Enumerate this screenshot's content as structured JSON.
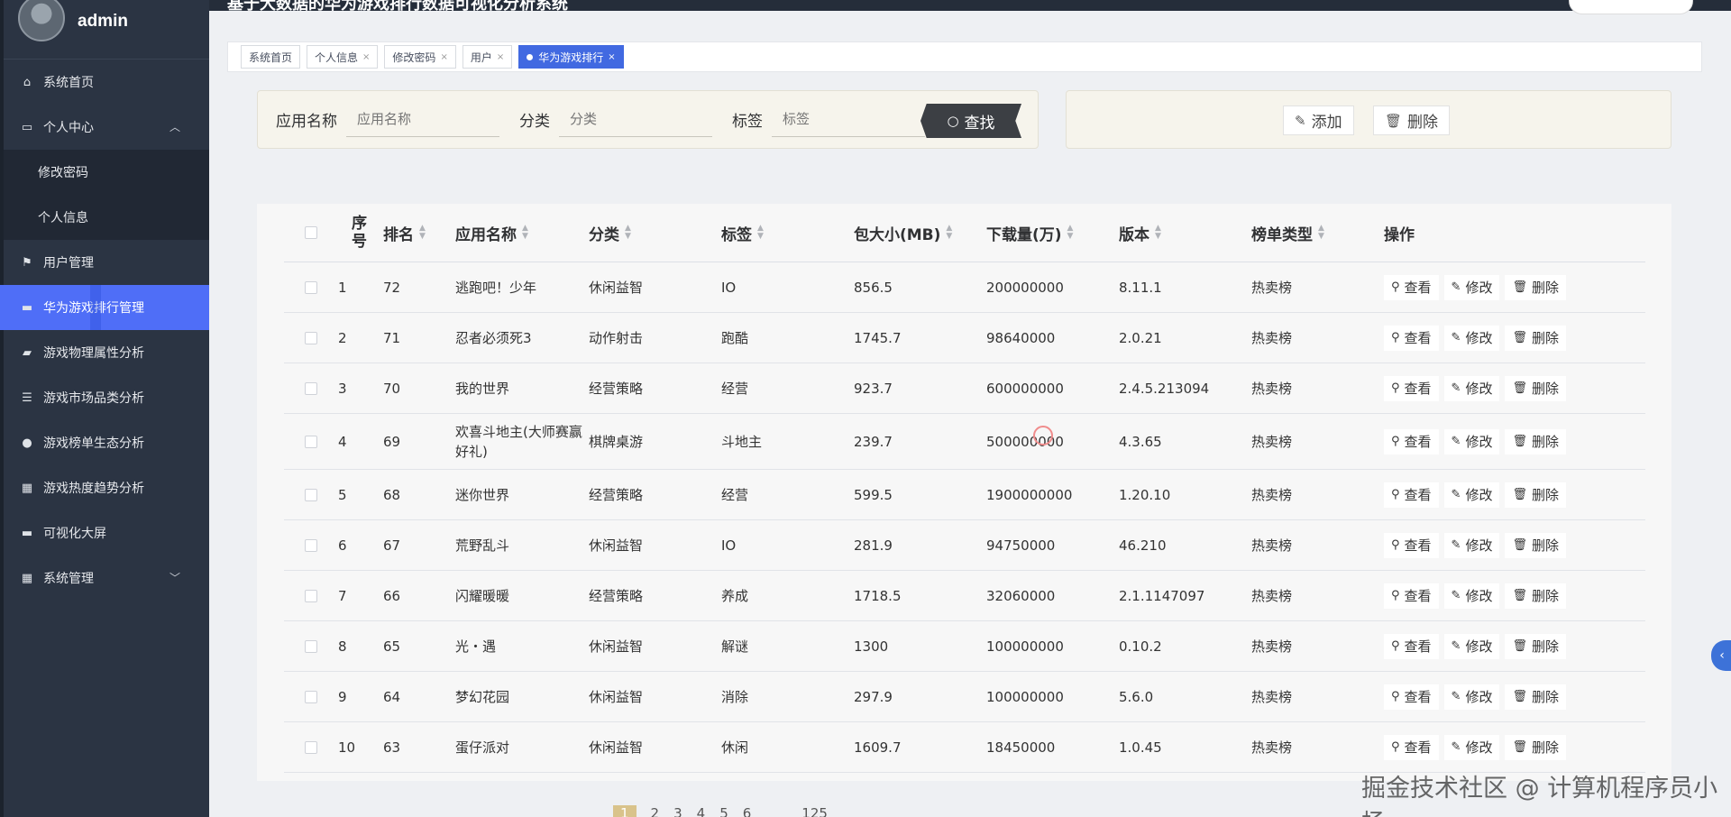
{
  "app": {
    "title": "基于大数据的华为游戏排行数据可视化分析系统",
    "user": "admin"
  },
  "sidebar": {
    "items": [
      {
        "label": "系统首页",
        "icon": "home-icon"
      },
      {
        "label": "个人中心",
        "icon": "id-card-icon",
        "expanded": true
      },
      {
        "label": "修改密码",
        "sub": true
      },
      {
        "label": "个人信息",
        "sub": true
      },
      {
        "label": "用户管理",
        "icon": "flag-icon"
      },
      {
        "label": "华为游戏排行管理",
        "icon": "monitor-icon",
        "active": true
      },
      {
        "label": "游戏物理属性分析",
        "icon": "briefcase-icon"
      },
      {
        "label": "游戏市场品类分析",
        "icon": "list-icon"
      },
      {
        "label": "游戏榜单生态分析",
        "icon": "person-icon"
      },
      {
        "label": "游戏热度趋势分析",
        "icon": "grid-icon"
      },
      {
        "label": "可视化大屏",
        "icon": "screen-icon"
      },
      {
        "label": "系统管理",
        "icon": "grid-icon",
        "collapsible": true
      }
    ]
  },
  "tabs": [
    {
      "label": "系统首页"
    },
    {
      "label": "个人信息"
    },
    {
      "label": "修改密码"
    },
    {
      "label": "用户"
    },
    {
      "label": "华为游戏排行",
      "active": true
    }
  ],
  "search": {
    "app_name_label": "应用名称",
    "app_name_placeholder": "应用名称",
    "category_label": "分类",
    "category_placeholder": "分类",
    "tag_label": "标签",
    "tag_placeholder": "标签",
    "find_label": "查找"
  },
  "actions": {
    "add_label": "添加",
    "delete_label": "删除"
  },
  "table": {
    "headers": [
      "序号",
      "排名",
      "应用名称",
      "分类",
      "标签",
      "包大小(MB)",
      "下载量(万)",
      "版本",
      "榜单类型",
      "操作"
    ],
    "op_labels": {
      "view": "查看",
      "edit": "修改",
      "delete": "删除"
    },
    "rows": [
      {
        "no": "1",
        "rank": "72",
        "name": "逃跑吧！少年",
        "category": "休闲益智",
        "tag": "IO",
        "size": "856.5",
        "downloads": "200000000",
        "version": "8.11.1",
        "list_type": "热卖榜"
      },
      {
        "no": "2",
        "rank": "71",
        "name": "忍者必须死3",
        "category": "动作射击",
        "tag": "跑酷",
        "size": "1745.7",
        "downloads": "98640000",
        "version": "2.0.21",
        "list_type": "热卖榜"
      },
      {
        "no": "3",
        "rank": "70",
        "name": "我的世界",
        "category": "经营策略",
        "tag": "经营",
        "size": "923.7",
        "downloads": "600000000",
        "version": "2.4.5.213094",
        "list_type": "热卖榜"
      },
      {
        "no": "4",
        "rank": "69",
        "name": "欢喜斗地主(大师赛赢好礼)",
        "category": "棋牌桌游",
        "tag": "斗地主",
        "size": "239.7",
        "downloads": "500000000",
        "version": "4.3.65",
        "list_type": "热卖榜"
      },
      {
        "no": "5",
        "rank": "68",
        "name": "迷你世界",
        "category": "经营策略",
        "tag": "经营",
        "size": "599.5",
        "downloads": "1900000000",
        "version": "1.20.10",
        "list_type": "热卖榜"
      },
      {
        "no": "6",
        "rank": "67",
        "name": "荒野乱斗",
        "category": "休闲益智",
        "tag": "IO",
        "size": "281.9",
        "downloads": "94750000",
        "version": "46.210",
        "list_type": "热卖榜"
      },
      {
        "no": "7",
        "rank": "66",
        "name": "闪耀暖暖",
        "category": "经营策略",
        "tag": "养成",
        "size": "1718.5",
        "downloads": "32060000",
        "version": "2.1.1147097",
        "list_type": "热卖榜"
      },
      {
        "no": "8",
        "rank": "65",
        "name": "光・遇",
        "category": "休闲益智",
        "tag": "解谜",
        "size": "1300",
        "downloads": "100000000",
        "version": "0.10.2",
        "list_type": "热卖榜"
      },
      {
        "no": "9",
        "rank": "64",
        "name": "梦幻花园",
        "category": "休闲益智",
        "tag": "消除",
        "size": "297.9",
        "downloads": "100000000",
        "version": "5.6.0",
        "list_type": "热卖榜"
      },
      {
        "no": "10",
        "rank": "63",
        "name": "蛋仔派对",
        "category": "休闲益智",
        "tag": "休闲",
        "size": "1609.7",
        "downloads": "18450000",
        "version": "1.0.45",
        "list_type": "热卖榜"
      }
    ]
  },
  "pagination": {
    "pages": [
      "1",
      "2",
      "3",
      "4",
      "5",
      "6"
    ],
    "current": "1",
    "last": "125"
  },
  "watermark": "掘金技术社区 @ 计算机程序员小杨"
}
